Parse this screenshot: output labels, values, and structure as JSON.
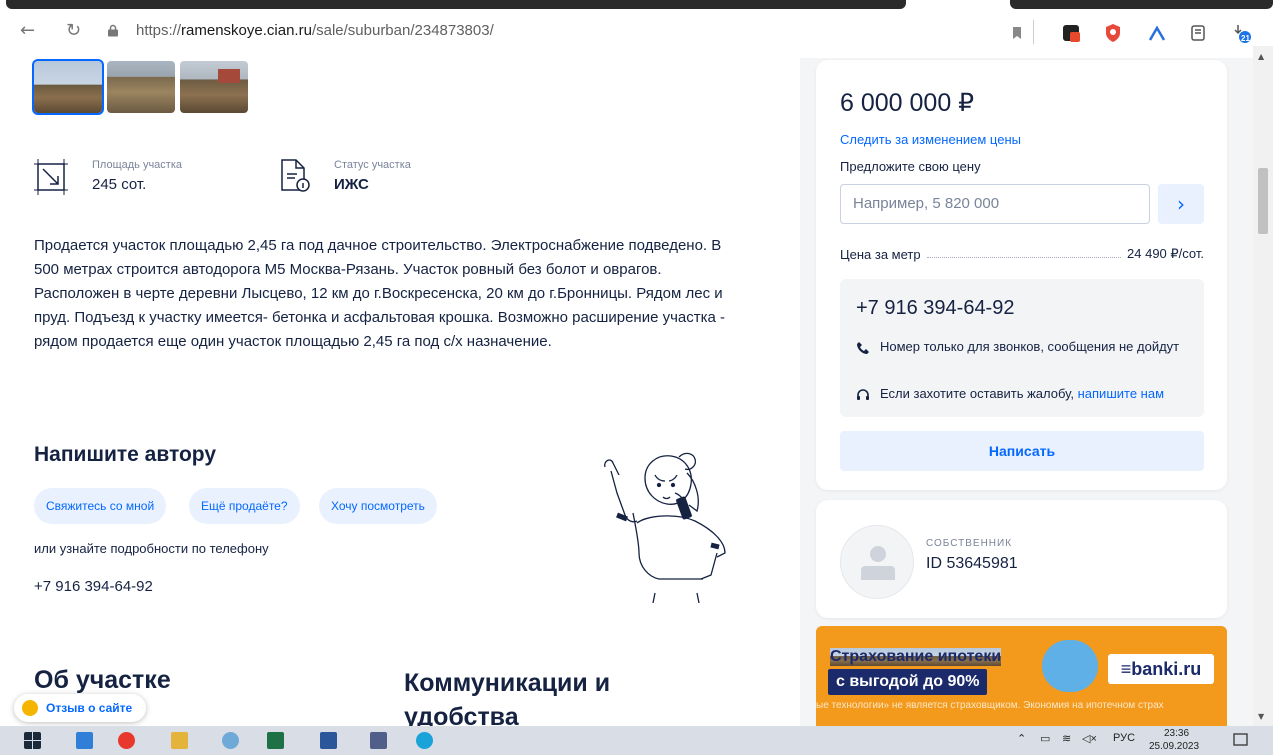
{
  "browser": {
    "url_prefix": "https://",
    "url_host": "ramenskoye.cian.ru",
    "url_path": "/sale/suburban/234873803/",
    "ext_badge_count": "21"
  },
  "listing": {
    "features": [
      {
        "label": "Площадь участка",
        "value": "245 сот.",
        "icon": "area-icon"
      },
      {
        "label": "Статус участка",
        "value": "ИЖС",
        "icon": "document-info-icon"
      }
    ],
    "description": "Продается участок площадью 2,45 га под дачное строительство. Электроснабжение подведено. В 500 метрах строится автодорога М5 Москва-Рязань. Участок ровный без болот и оврагов. Расположен в черте деревни Лысцево, 12 км до г.Воскресенска, 20 км до г.Бронницы. Рядом лес и пруд. Подъезд к участку имеется- бетонка и асфальтовая крошка. Возможно расширение участка - рядом продается еще один участок площадью 2,45 га под с/х назначение."
  },
  "write_author": {
    "title": "Напишите автору",
    "chips": [
      "Свяжитесь со мной",
      "Ещё продаёте?",
      "Хочу посмотреть"
    ],
    "hint": "или узнайте подробности по телефону",
    "phone": "+7 916 394-64-92"
  },
  "sections": {
    "about": "Об участке",
    "comms": "Коммуникации и удобства"
  },
  "feedback_label": "Отзыв о сайте",
  "price_card": {
    "price": "6 000 000 ₽",
    "follow_link": "Следить за изменением цены",
    "offer_label": "Предложите свою цену",
    "offer_placeholder": "Например, 5 820 000",
    "ppm_label": "Цена за метр",
    "ppm_value": "24 490 ₽/сот.",
    "phone": "+7 916 394-64-92",
    "calls_only": "Номер только для звонков, сообщения не дойдут",
    "complaint_text": "Если захотите оставить жалобу,",
    "complaint_link": "напишите нам",
    "write_button": "Написать"
  },
  "owner_card": {
    "role": "СОБСТВЕННИК",
    "id": "ID 53645981"
  },
  "ad": {
    "line1": "Страхование ипотеки",
    "line2": "с выгодой до 90%",
    "logo": "≡banki.ru",
    "ticker": "ые технологии» не является страховщиком. Экономия на ипотечном страх"
  },
  "taskbar": {
    "lang": "РУС",
    "time": "23:36",
    "date": "25.09.2023"
  },
  "colors": {
    "accent": "#0468ff",
    "text": "#152242",
    "ad_orange": "#f39a1c"
  }
}
